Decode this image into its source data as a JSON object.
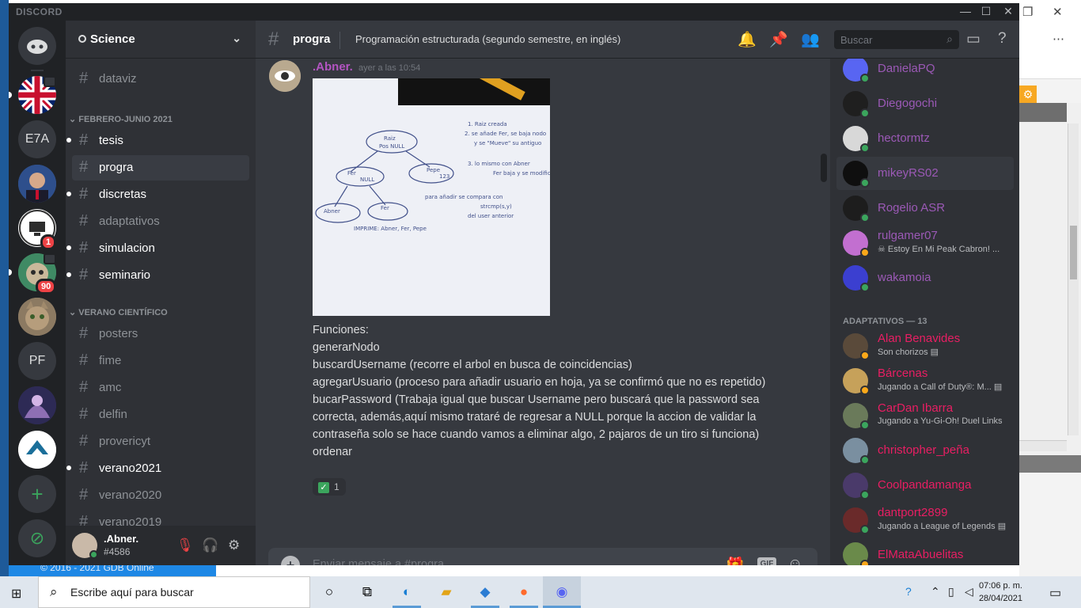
{
  "app": {
    "brand": "DISCORD"
  },
  "background": {
    "footer_text": "© 2016 - 2021 GDB Online"
  },
  "server": {
    "name": "Science"
  },
  "guilds": [
    {
      "name": "uk-flag-server",
      "label": ""
    },
    {
      "name": "E7A",
      "label": "E7A"
    },
    {
      "name": "portrait-server",
      "label": ""
    },
    {
      "name": "computer-logo-server",
      "label": "",
      "badge": "1"
    },
    {
      "name": "sloth-server",
      "label": "",
      "badge": "90"
    },
    {
      "name": "cat-server",
      "label": ""
    },
    {
      "name": "PF",
      "label": "PF"
    },
    {
      "name": "art-server",
      "label": ""
    },
    {
      "name": "warframe-server",
      "label": ""
    }
  ],
  "channel_list": {
    "top_partial": "dataviz",
    "categories": [
      {
        "title": "FEBRERO-JUNIO 2021",
        "channels": [
          "tesis",
          "progra",
          "discretas",
          "adaptativos",
          "simulacion",
          "seminario"
        ]
      },
      {
        "title": "VERANO CIENTÍFICO",
        "channels": [
          "posters",
          "fime",
          "amc",
          "delfin",
          "provericyt",
          "verano2021",
          "verano2020",
          "verano2019"
        ]
      }
    ],
    "unread": [
      "tesis",
      "discretas",
      "simulacion",
      "seminario",
      "verano2021"
    ],
    "active": "progra"
  },
  "user": {
    "name": ".Abner.",
    "tag": "#4586"
  },
  "channel_header": {
    "name": "progra",
    "topic": "Programación estructurada (segundo semestre, en inglés)",
    "search_placeholder": "Buscar"
  },
  "message": {
    "author": ".Abner.",
    "timestamp": "ayer a las 10:54",
    "lines": [
      "Funciones:",
      "generarNodo",
      "buscardUsername (recorre el arbol en busca de coincidencias)",
      "agregarUsuario (proceso para añadir usuario en hoja, ya se confirmó que no es repetido)",
      "bucarPassword (Trabaja igual que buscar Username pero buscará que la password sea correcta, además,aquí mismo trataré de regresar a NULL porque la accion de validar la contraseña solo se hace cuando vamos a eliminar algo, 2 pajaros de un tiro si funciona)",
      "ordenar"
    ],
    "reaction_count": "1",
    "image_notes": {
      "root": "Raiz",
      "root2": "Pos NULL",
      "fer": "Fer",
      "null": "NULL",
      "pepe": "Pepe",
      "n123": "123",
      "abner": "Abner",
      "fer2": "Fer",
      "imprime": "IMPRIME: Abner, Fer, Pepe",
      "note1": "1. Raiz creada",
      "note2": "2. se añade Fer, se baja nodo",
      "note3": "y se \"Mueve\" su antiguo",
      "note4": "3. lo mismo con Abner",
      "note5": "Fer baja y se modifica",
      "note6": "para añadir se compara con",
      "note7": "strcmp(s,y)",
      "note8": "del user anterior"
    }
  },
  "composer": {
    "placeholder": "Enviar mensaje a #progra",
    "gif_label": "GIF"
  },
  "members": {
    "online": [
      {
        "name": "DanielaPQ",
        "color": "#9b59b6",
        "status": "online"
      },
      {
        "name": "Diegogochi",
        "color": "#9b59b6",
        "status": "online"
      },
      {
        "name": "hectormtz",
        "color": "#9b59b6",
        "status": "online"
      },
      {
        "name": "mikeyRS02",
        "color": "#9b59b6",
        "status": "online"
      },
      {
        "name": "Rogelio ASR",
        "color": "#9b59b6",
        "status": "online"
      },
      {
        "name": "rulgamer07",
        "color": "#9b59b6",
        "status": "idle",
        "activity": "Estoy En Mi Peak Cabron! ..."
      },
      {
        "name": "wakamoia",
        "color": "#9b59b6",
        "status": "online"
      }
    ],
    "category": "ADAPTATIVOS — 13",
    "adaptativos": [
      {
        "name": "Alan Benavides",
        "color": "#e91e63",
        "status": "idle",
        "activity": "Son chorizos"
      },
      {
        "name": "Bárcenas",
        "color": "#e91e63",
        "status": "idle",
        "activity": "Jugando a Call of Duty®: M..."
      },
      {
        "name": "CarDan Ibarra",
        "color": "#e91e63",
        "status": "online",
        "activity": "Jugando a Yu-Gi-Oh! Duel Links"
      },
      {
        "name": "christopher_peña",
        "color": "#e91e63",
        "status": "online"
      },
      {
        "name": "Coolpandamanga",
        "color": "#e91e63",
        "status": "online"
      },
      {
        "name": "dantport2899",
        "color": "#e91e63",
        "status": "online",
        "activity": "Jugando a League of Legends"
      },
      {
        "name": "ElMataAbuelitas",
        "color": "#e91e63",
        "status": "idle"
      }
    ]
  },
  "taskbar": {
    "search_placeholder": "Escribe aquí para buscar",
    "time": "07:06 p. m.",
    "date": "28/04/2021"
  },
  "colors": {
    "accent": "#5865f2",
    "online": "#3ba55d",
    "idle": "#faa81a",
    "mention": "#ed4245"
  }
}
